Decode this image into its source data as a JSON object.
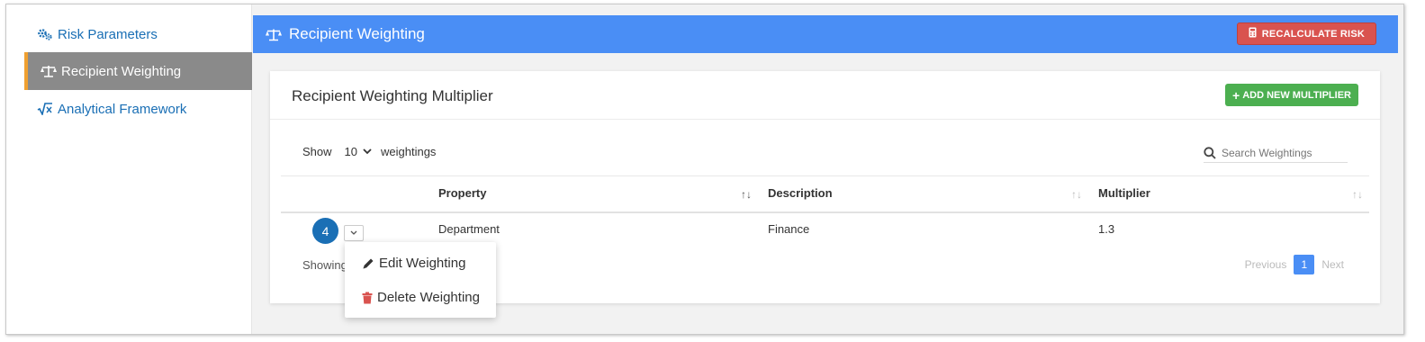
{
  "sidebar": {
    "items": [
      {
        "label": "Risk Parameters",
        "icon": "gears-icon",
        "active": false
      },
      {
        "label": "Recipient Weighting",
        "icon": "balance-scale-icon",
        "active": true
      },
      {
        "label": "Analytical Framework",
        "icon": "square-root-icon",
        "active": false
      }
    ]
  },
  "header": {
    "title": "Recipient Weighting",
    "recalculate_label": "RECALCULATE RISK"
  },
  "card": {
    "title": "Recipient Weighting Multiplier",
    "add_label": "ADD NEW MULTIPLIER",
    "show_label": "Show",
    "page_length": "10",
    "length_suffix": "weightings",
    "search_placeholder": "Search Weightings"
  },
  "table": {
    "columns": [
      "Property",
      "Description",
      "Multiplier"
    ],
    "rows": [
      {
        "number": "4",
        "property": "Department",
        "description": "Finance",
        "multiplier": "1.3"
      }
    ]
  },
  "footer": {
    "showing_label": "Showing",
    "previous_label": "Previous",
    "current_page": "1",
    "next_label": "Next"
  },
  "row_menu": {
    "edit_label": "Edit Weighting",
    "delete_label": "Delete Weighting"
  },
  "colors": {
    "accent_blue": "#4a8ef5",
    "link_blue": "#1a6fb5",
    "danger_red": "#d9534f",
    "success_green": "#4caf50",
    "active_nav_bg": "#8a8a8a",
    "active_nav_border": "#f0a030"
  }
}
